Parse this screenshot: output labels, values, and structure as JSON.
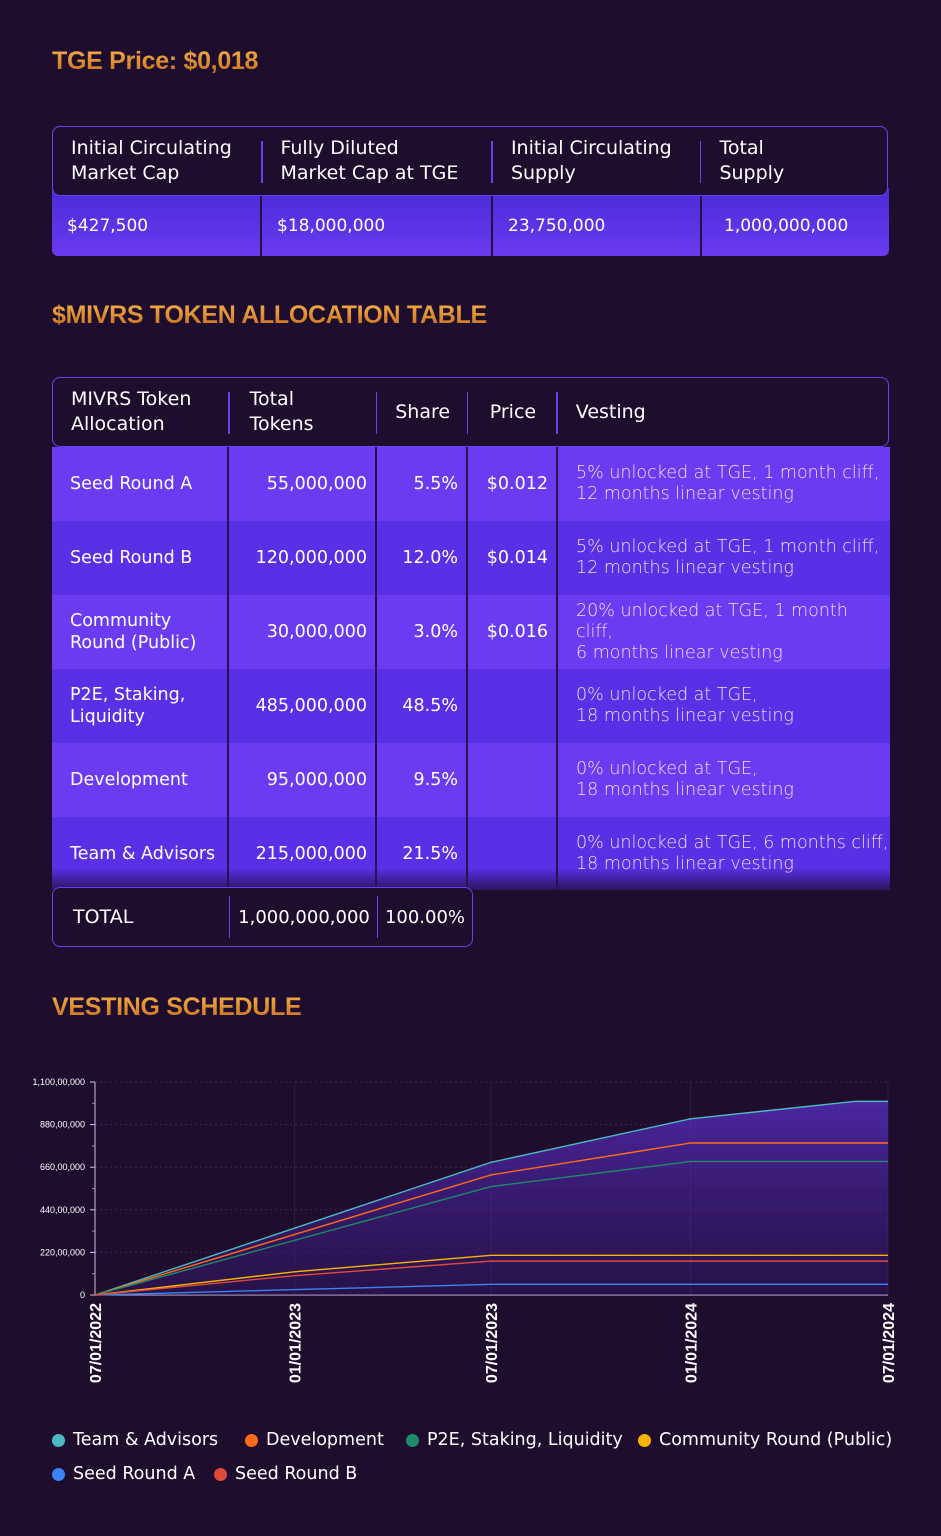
{
  "tge_price": "TGE Price: $0,018",
  "stats": {
    "headers": [
      "Initial Circulating\nMarket Cap",
      "Fully Diluted\nMarket Cap at TGE",
      "Initial Circulating\nSupply",
      "Total\nSupply"
    ],
    "values": [
      "$427,500",
      "$18,000,000",
      "23,750,000",
      "1,000,000,000"
    ]
  },
  "allocation_title": "$MIVRS TOKEN ALLOCATION TABLE",
  "allocation": {
    "headers": [
      "MIVRS Token\nAllocation",
      "Total\nTokens",
      "Share",
      "Price",
      "Vesting"
    ],
    "rows": [
      {
        "name": "Seed Round A",
        "tokens": "55,000,000",
        "share": "5.5%",
        "price": "$0.012",
        "vesting": "5% unlocked at TGE, 1 month cliff,\n12 months linear vesting"
      },
      {
        "name": "Seed Round B",
        "tokens": "120,000,000",
        "share": "12.0%",
        "price": "$0.014",
        "vesting": "5% unlocked at TGE, 1 month cliff,\n12 months linear vesting"
      },
      {
        "name": "Community\nRound (Public)",
        "tokens": "30,000,000",
        "share": "3.0%",
        "price": "$0.016",
        "vesting": "20% unlocked at TGE, 1 month cliff,\n6 months linear vesting"
      },
      {
        "name": "P2E, Staking,\nLiquidity",
        "tokens": "485,000,000",
        "share": "48.5%",
        "price": "",
        "vesting": "0% unlocked at TGE,\n18 months linear vesting"
      },
      {
        "name": "Development",
        "tokens": "95,000,000",
        "share": "9.5%",
        "price": "",
        "vesting": "0% unlocked at TGE,\n18 months linear vesting"
      },
      {
        "name": "Team & Advisors",
        "tokens": "215,000,000",
        "share": "21.5%",
        "price": "",
        "vesting": "0% unlocked at TGE, 6 months cliff,\n18 months linear vesting"
      }
    ],
    "total": {
      "label": "TOTAL",
      "tokens": "1,000,000,000",
      "share": "100.00%"
    }
  },
  "vesting_title": "VESTING SCHEDULE",
  "chart_data": {
    "type": "area",
    "title": "VESTING SCHEDULE",
    "xlabel": "",
    "ylabel": "",
    "x_ticks": [
      "07/01/2022",
      "01/01/2023",
      "07/01/2023",
      "01/01/2024",
      "07/01/2024"
    ],
    "y_ticks": [
      "0",
      "220,00,000",
      "440,00,000",
      "660,00,000",
      "880,00,000",
      "1,100,00,000"
    ],
    "ylim": [
      0,
      1100000000
    ],
    "xlim": [
      "2022-07-01",
      "2024-07-01"
    ],
    "grid": true,
    "legend": "bottom",
    "series": [
      {
        "name": "Team & Advisors",
        "color": "#4cb8c4",
        "x": [
          "2022-07-01",
          "2023-07-01",
          "2024-01-01",
          "2024-06-01",
          "2024-07-01"
        ],
        "y": [
          0,
          685000000,
          910000000,
          1000000000,
          1000000000
        ]
      },
      {
        "name": "Development",
        "color": "#ff6a1a",
        "x": [
          "2022-07-01",
          "2023-07-01",
          "2024-01-01",
          "2024-07-01"
        ],
        "y": [
          0,
          620000000,
          785000000,
          785000000
        ]
      },
      {
        "name": "P2E, Staking, Liquidity",
        "color": "#1f8a6a",
        "x": [
          "2022-07-01",
          "2023-07-01",
          "2024-01-01",
          "2024-07-01"
        ],
        "y": [
          0,
          560000000,
          690000000,
          690000000
        ]
      },
      {
        "name": "Community Round (Public)",
        "color": "#f6b400",
        "x": [
          "2022-07-01",
          "2023-01-01",
          "2023-07-01",
          "2024-07-01"
        ],
        "y": [
          0,
          120000000,
          205000000,
          205000000
        ]
      },
      {
        "name": "Seed Round A",
        "color": "#3b82f6",
        "x": [
          "2022-07-01",
          "2023-07-01",
          "2024-07-01"
        ],
        "y": [
          0,
          55000000,
          55000000
        ]
      },
      {
        "name": "Seed Round B",
        "color": "#e04a3c",
        "x": [
          "2022-07-01",
          "2023-01-01",
          "2023-07-01",
          "2024-07-01"
        ],
        "y": [
          0,
          100000000,
          175000000,
          175000000
        ]
      }
    ]
  }
}
